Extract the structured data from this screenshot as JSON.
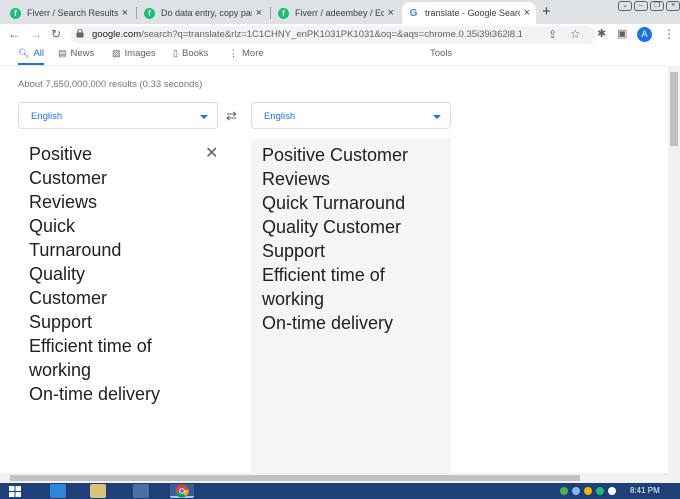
{
  "browser": {
    "tabs": [
      {
        "title": "Fiverr / Search Results for",
        "favicon": "fiverr-icon"
      },
      {
        "title": "Do data entry, copy paste",
        "favicon": "fiverr-icon"
      },
      {
        "title": "Fiverr / adeembey / Edit",
        "favicon": "fiverr-icon"
      },
      {
        "title": "translate - Google Search",
        "favicon": "google-icon",
        "active": true
      }
    ],
    "new_tab_label": "+",
    "url_host": "google.com",
    "url_rest": "/search?q=translate&rlz=1C1CHNY_enPK1031PK1031&oq=&aqs=chrome.0.35i39i362l8.13583...",
    "profile_initial": "A"
  },
  "search_nav": {
    "items": [
      {
        "label": "All",
        "icon": "search-icon"
      },
      {
        "label": "News",
        "icon": "news-icon"
      },
      {
        "label": "Images",
        "icon": "image-icon"
      },
      {
        "label": "Books",
        "icon": "book-icon"
      },
      {
        "label": "More",
        "icon": "more-vert-icon"
      }
    ],
    "tools_label": "Tools"
  },
  "result_stats": "About 7,650,000,000 results (0.33 seconds)",
  "translate": {
    "source_language": "English",
    "target_language": "English",
    "source_text": "Positive\nCustomer\nReviews\nQuick\nTurnaround\nQuality\nCustomer\nSupport\nEfficient time of\nworking\nOn-time delivery",
    "target_text": "Positive Customer\nReviews\nQuick Turnaround\nQuality Customer\nSupport\nEfficient time of\nworking\nOn-time delivery"
  },
  "taskbar": {
    "time": "8:41 PM"
  },
  "colors": {
    "accent": "#1a73e8",
    "tab_strip": "#dee1e6",
    "fiverr_green": "#1dbf73",
    "taskbar": "#1f3f78"
  }
}
